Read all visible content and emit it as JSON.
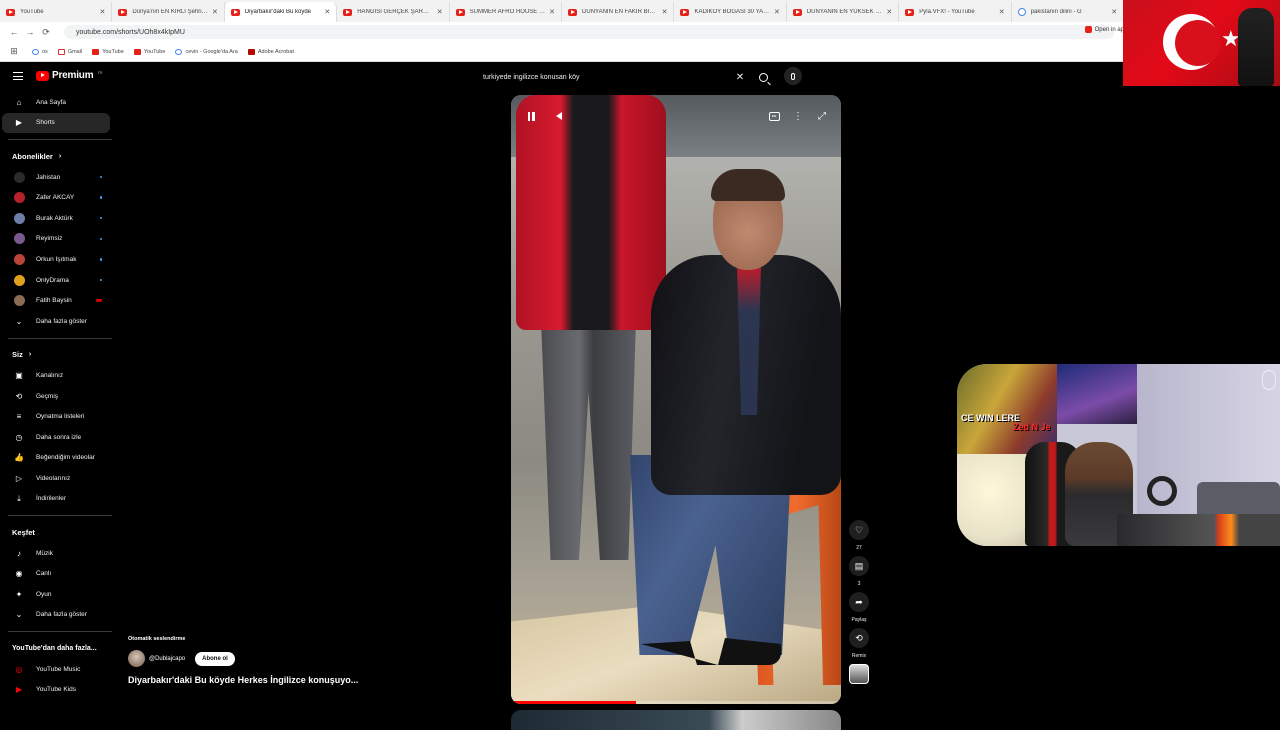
{
  "browser": {
    "tabs": [
      {
        "title": "YouTube",
        "type": "yt"
      },
      {
        "title": "Dünya'nın EN KİRLİ Şehrine Gi",
        "type": "yt"
      },
      {
        "title": "Diyarbakır'daki Bu köyde",
        "type": "yt",
        "active": true
      },
      {
        "title": "HANGİSİ GERÇEK ŞARKICI? Ha",
        "type": "yt"
      },
      {
        "title": "SUMMER AFRO HOUSE Sunse",
        "type": "yt"
      },
      {
        "title": "DÜNYANIN EN FAKİR BİT PAZ",
        "type": "yt"
      },
      {
        "title": "KADIKÖY BOĞASI 30 YAŞINDA",
        "type": "yt"
      },
      {
        "title": "DÜNYANIN EN YÜKSEK OTELİ",
        "type": "yt"
      },
      {
        "title": "Pyla.VFX! - YouTube",
        "type": "yt"
      },
      {
        "title": "pakistanın dilini - G",
        "type": "google"
      }
    ],
    "url": "youtube.com/shorts/UOh8x4kIpMU",
    "open_in_app": "Open in ap",
    "bookmarks": [
      {
        "label": "os",
        "icon": "google"
      },
      {
        "label": "Gmail",
        "icon": "gmail"
      },
      {
        "label": "YouTube",
        "icon": "youtube"
      },
      {
        "label": "YouTube",
        "icon": "youtube"
      },
      {
        "label": "cevin - Google'da Ara",
        "icon": "google"
      },
      {
        "label": "Adobe Acrobat",
        "icon": "acrobat"
      }
    ]
  },
  "header": {
    "logo_text": "Premium",
    "logo_sup": "TR",
    "search_query": "turkiyede ingilizce konusan köy"
  },
  "sidebar": {
    "main": [
      {
        "label": "Ana Sayfa",
        "icon": "home-icon"
      },
      {
        "label": "Shorts",
        "icon": "shorts-icon",
        "active": true
      }
    ],
    "subscriptions_title": "Abonelikler",
    "subscriptions": [
      {
        "label": "Jahistan",
        "color": "#2b2b2b",
        "dot": "blue"
      },
      {
        "label": "Zafer AKCAY",
        "color": "#b4232a",
        "dot": "blue"
      },
      {
        "label": "Burak Aktürk",
        "color": "#6d7ea8",
        "dot": "blue"
      },
      {
        "label": "Reyimsiz",
        "color": "#7a5a8e",
        "dot": "blue"
      },
      {
        "label": "Orkun Işıtmak",
        "color": "#b8443a",
        "dot": "blue"
      },
      {
        "label": "OnlyDrama",
        "color": "#e0a21d",
        "dot": "blue"
      },
      {
        "label": "Fatih Baysin",
        "color": "#8b6b52",
        "dot": "red"
      }
    ],
    "show_more": "Daha fazla göster",
    "you_title": "Siz",
    "you": [
      {
        "label": "Kanalınız",
        "icon": "channel-icon"
      },
      {
        "label": "Geçmiş",
        "icon": "history-icon"
      },
      {
        "label": "Oynatma listeleri",
        "icon": "playlists-icon"
      },
      {
        "label": "Daha sonra izle",
        "icon": "watch-later-icon"
      },
      {
        "label": "Beğendiğim videolar",
        "icon": "like-icon"
      },
      {
        "label": "Videolarınız",
        "icon": "your-videos-icon"
      },
      {
        "label": "İndirilenler",
        "icon": "download-icon"
      }
    ],
    "explore_title": "Keşfet",
    "explore": [
      {
        "label": "Müzik",
        "icon": "music-icon"
      },
      {
        "label": "Canlı",
        "icon": "live-icon"
      },
      {
        "label": "Oyun",
        "icon": "gaming-icon"
      }
    ],
    "explore_more": "Daha fazla göster",
    "more_title": "YouTube'dan daha fazla...",
    "more": [
      {
        "label": "YouTube Music",
        "icon": "youtube-music-icon"
      },
      {
        "label": "YouTube Kids",
        "icon": "youtube-kids-icon"
      }
    ]
  },
  "short": {
    "auto_dub": "Otomatik seslendirme",
    "channel": "@Dublajcapo",
    "subscribe": "Abone ol",
    "title": "Diyarbakır'daki Bu köyde Herkes İngilizce konuşuyo...",
    "progress": 0.38,
    "likes": "27",
    "comments": "3",
    "share": "Paylaş",
    "remix": "Remix"
  },
  "webcam": {
    "poster_line1": "CE WIN LERE",
    "poster_line2": "Zed N Je"
  },
  "colors": {
    "accent": "#ff0000",
    "bg": "#0f0f0f",
    "active_item": "#272727"
  }
}
